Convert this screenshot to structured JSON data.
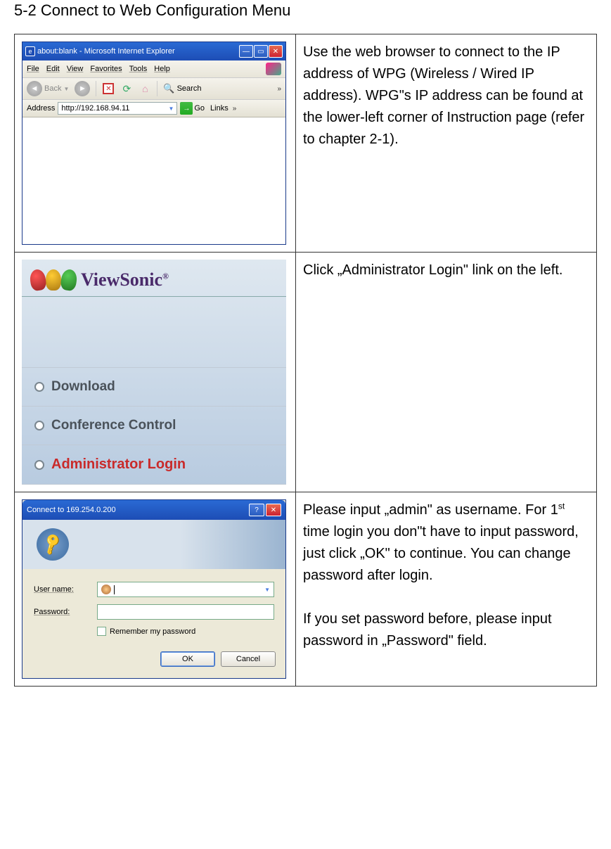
{
  "section_title": "5-2 Connect to Web Configuration Menu",
  "rows": [
    {
      "desc": "Use the web browser to connect to the IP address of WPG (Wireless / Wired IP address). WPG\"s IP address can be found at the lower-left corner of Instruction page (refer to chapter 2-1).",
      "ie": {
        "title": "about:blank - Microsoft Internet Explorer",
        "menus": [
          "File",
          "Edit",
          "View",
          "Favorites",
          "Tools",
          "Help"
        ],
        "back_label": "Back",
        "search_label": "Search",
        "address_label": "Address",
        "url": "http://192.168.94.11",
        "go_label": "Go",
        "links_label": "Links"
      }
    },
    {
      "desc": "Click „Administrator Login\" link on the left.",
      "vs": {
        "logo_text": "ViewSonic",
        "links": [
          "Download",
          "Conference Control",
          "Administrator Login"
        ]
      }
    },
    {
      "desc_p1": "Please input „admin\" as username. For 1",
      "desc_p1_sup": "st",
      "desc_p1_cont": " time login you don\"t have to input password, just click „OK\" to continue. You can change password after login.",
      "desc_p2": "If you set password before, please input password in „Password\" field.",
      "auth": {
        "title": "Connect to 169.254.0.200",
        "user_label": "User name:",
        "pass_label": "Password:",
        "user_value": "",
        "remember_label": "Remember my password",
        "ok_label": "OK",
        "cancel_label": "Cancel"
      }
    }
  ]
}
